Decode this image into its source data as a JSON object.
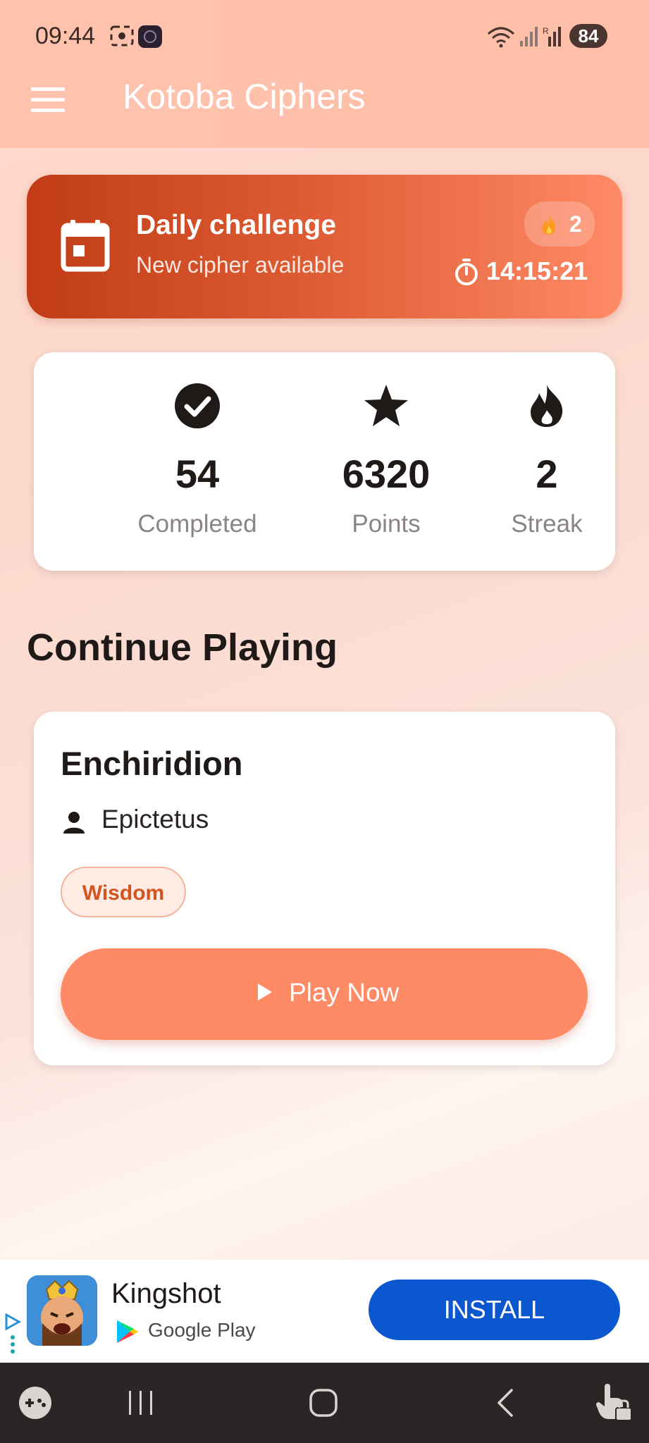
{
  "status_bar": {
    "time": "09:44",
    "battery": "84",
    "icons": [
      "screenshot-icon",
      "app-badge-icon",
      "wifi-icon",
      "signal-icon",
      "signal-r-icon"
    ]
  },
  "app_bar": {
    "title": "Kotoba Ciphers",
    "menu_icon": "hamburger-menu-icon"
  },
  "daily_challenge": {
    "title": "Daily challenge",
    "subtitle": "New cipher available",
    "streak": "2",
    "timer": "14:15:21",
    "icon": "calendar-icon"
  },
  "stats": [
    {
      "icon": "check-circle-icon",
      "value": "54",
      "label": "Completed"
    },
    {
      "icon": "star-icon",
      "value": "6320",
      "label": "Points"
    },
    {
      "icon": "flame-icon",
      "value": "2",
      "label": "Streak"
    }
  ],
  "continue_section": {
    "title": "Continue Playing",
    "book": {
      "title": "Enchiridion",
      "author": "Epictetus",
      "tag": "Wisdom",
      "play_label": "Play Now"
    }
  },
  "ad": {
    "title": "Kingshot",
    "store": "Google Play",
    "install_label": "INSTALL"
  },
  "nav_bar": {
    "items": [
      "game-launcher-icon",
      "recents-icon",
      "home-icon",
      "back-icon",
      "touch-lock-icon"
    ]
  },
  "colors": {
    "accent": "#ff8a66",
    "daily_gradient_start": "#c13c16",
    "install_blue": "#0b57d0",
    "tag_text": "#d4541f"
  }
}
